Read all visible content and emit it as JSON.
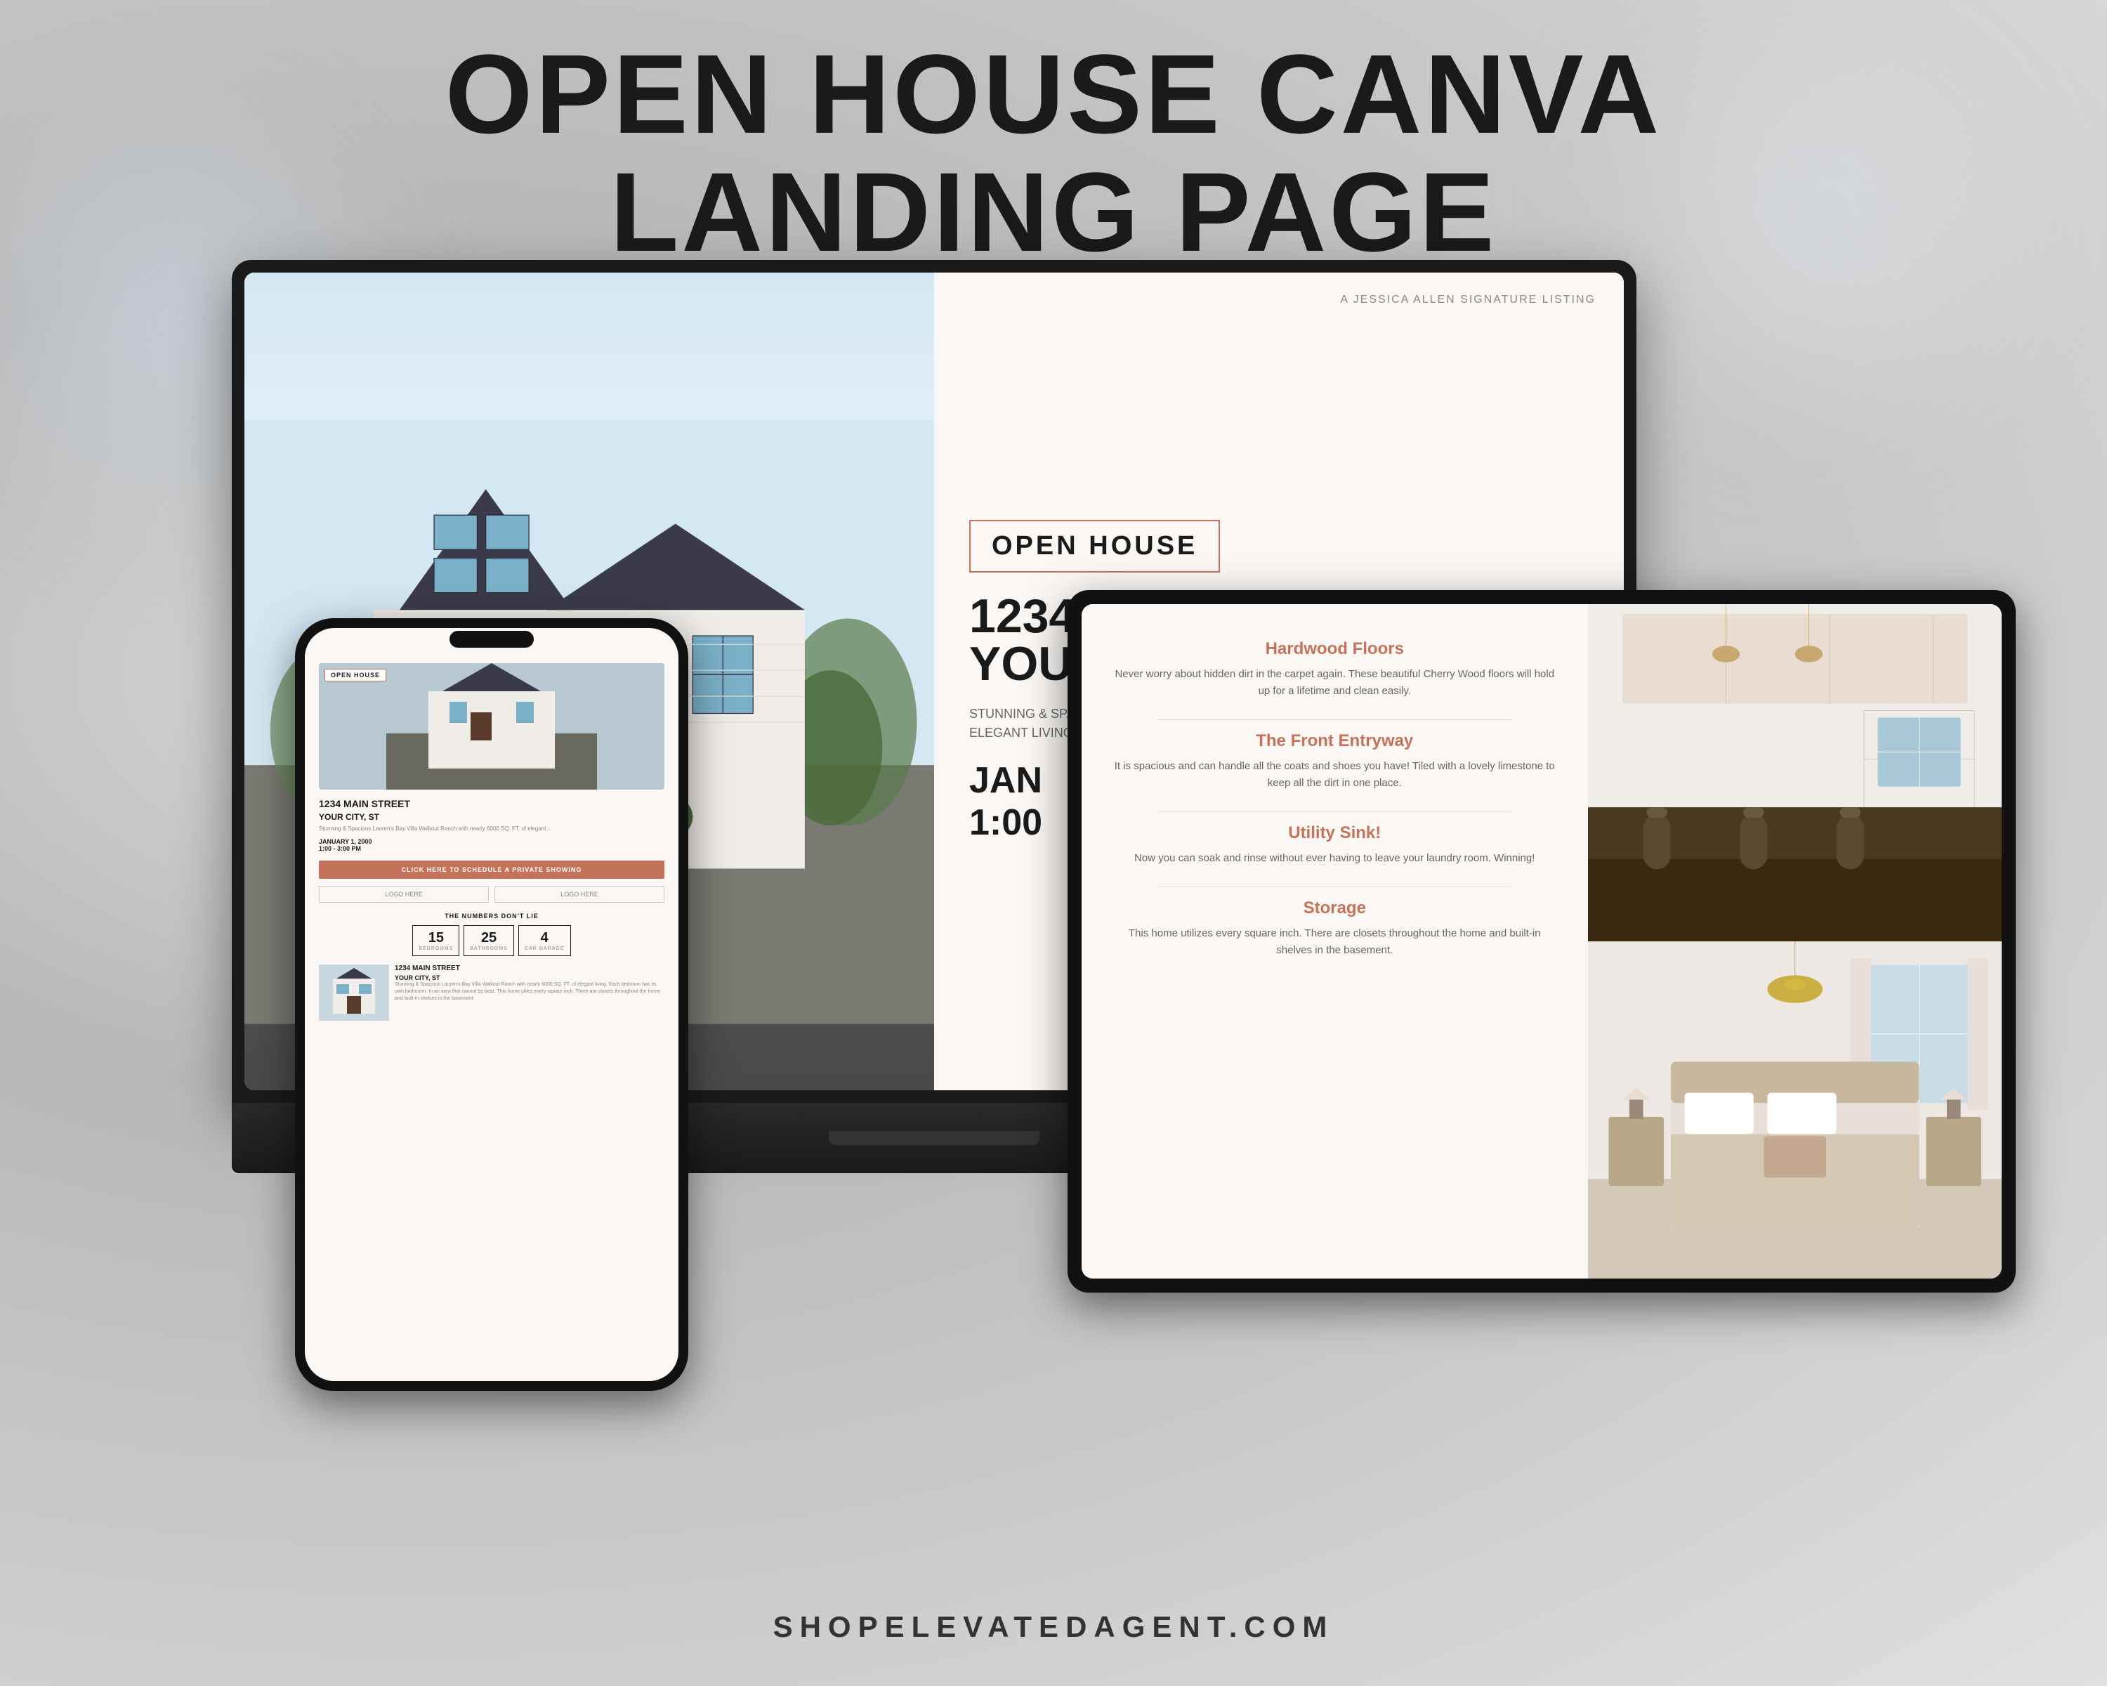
{
  "page": {
    "background": "blurred gray gradient",
    "title_line1": "OPEN HOUSE CANVA",
    "title_line2": "LANDING PAGE",
    "footer_domain": "SHOPELEVATEDAGENT.COM"
  },
  "laptop": {
    "agent_label": "A JESSICA ALLEN SIGNATURE LISTING",
    "open_house_badge": "OPEN HOUSE",
    "address_line1": "1234 MAIN STREET",
    "address_line2": "YOUR CITY, ST",
    "description": "STUNNING & SPACIOUS LAUREN'S BAY VILLA WALKOUT RANCH WITH NEARLY 6000 SQ. FT. OF ELEGANT LIVING. FULL &",
    "date_partial": "JAN",
    "time_partial": "1:00"
  },
  "phone": {
    "open_badge": "OPEN HOUSE",
    "address": "1234 MAIN STREET",
    "city": "YOUR CITY, ST",
    "subtext": "Stunning & Spacious Lauren's Bay Villa Walkout Ranch with nearly 6000 SQ. FT. of elegant...",
    "date": "JANUARY 1, 2000",
    "time": "1:00 - 3:00 PM",
    "cta_button": "CLICK HERE TO SCHEDULE A PRIVATE SHOWING",
    "logo1": "LOGO HERE",
    "logo2": "LOGO HERE",
    "numbers_title": "THE NUMBERS DON'T LIE",
    "bedrooms_val": "15",
    "bedrooms_label": "BEDROOMS",
    "bathrooms_val": "25",
    "bathrooms_label": "BATHROOMS",
    "garage_val": "4",
    "garage_label": "CAR GARAGE",
    "property_address": "1234 MAIN STREET",
    "property_city": "YOUR CITY, ST",
    "property_desc": "Stunning & Spacious Lauren's Bay Villa Walkout Ranch with nearly 6000 SQ. FT. of elegant living. Each bedroom has its own bathroom. In an area that cannot be beat. This home utiles every square inch. There are closets throughout the home and built-in shelves in the basement."
  },
  "tablet": {
    "feature1_title": "Hardwood Floors",
    "feature1_text": "Never worry about hidden dirt in the carpet again. These beautiful Cherry Wood floors will hold up for a lifetime and clean easily.",
    "feature2_title": "The Front Entryway",
    "feature2_text": "It is spacious and can handle all the coats and shoes you have! Tiled with a lovely limestone to keep all the dirt in one place.",
    "feature3_title": "Utility Sink!",
    "feature3_text": "Now you can soak and rinse without ever having to leave your laundry room. Winning!",
    "feature4_title": "Storage",
    "feature4_text": "This home utilizes every square inch. There are closets throughout the home and built-in shelves in the basement."
  }
}
